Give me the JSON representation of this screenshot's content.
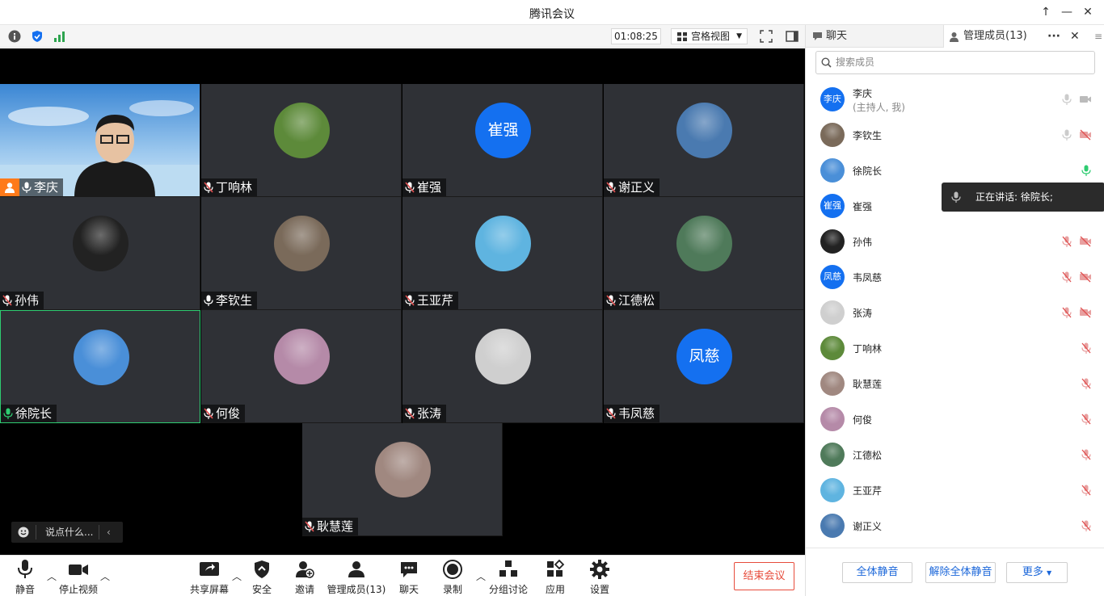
{
  "window": {
    "title": "腾讯会议"
  },
  "toolbar": {
    "timer": "01:08:25",
    "view_label": "宫格视图"
  },
  "tiles": [
    {
      "name": "李庆",
      "mic": "on",
      "self": true
    },
    {
      "name": "丁响林",
      "mic": "muted",
      "avatar_color": "#5d8a3a"
    },
    {
      "name": "崔强",
      "mic": "muted",
      "avatar_text": "崔强"
    },
    {
      "name": "谢正义",
      "mic": "muted",
      "avatar_color": "#4a7ab0"
    },
    {
      "name": "孙伟",
      "mic": "muted",
      "avatar_color": "#222222"
    },
    {
      "name": "李钦生",
      "mic": "on",
      "avatar_color": "#7a6a5a"
    },
    {
      "name": "王亚芹",
      "mic": "muted",
      "avatar_color": "#5fb4e0"
    },
    {
      "name": "江德松",
      "mic": "muted",
      "avatar_color": "#4f7a5a"
    },
    {
      "name": "徐院长",
      "mic": "speaking",
      "avatar_color": "#4a8fd8",
      "active": true
    },
    {
      "name": "何俊",
      "mic": "muted",
      "avatar_color": "#b58aa8"
    },
    {
      "name": "张涛",
      "mic": "muted",
      "avatar_color": "#cfcfcf"
    },
    {
      "name": "韦凤慈",
      "mic": "muted",
      "avatar_text": "凤慈"
    },
    {
      "name": "耿慧莲",
      "mic": "muted",
      "avatar_color": "#a08880"
    }
  ],
  "chat_input": {
    "placeholder": "说点什么..."
  },
  "bottom": {
    "mute": "静音",
    "stop_video": "停止视频",
    "share": "共享屏幕",
    "security": "安全",
    "invite": "邀请",
    "members": "管理成员(13)",
    "chat": "聊天",
    "record": "录制",
    "breakout": "分组讨论",
    "apps": "应用",
    "settings": "设置",
    "end": "结束会议"
  },
  "sidebar": {
    "tab_chat": "聊天",
    "tab_members": "管理成员(13)",
    "search_placeholder": "搜索成员",
    "speaking_label": "正在讲话: 徐院长;",
    "members": [
      {
        "name": "李庆",
        "sub": "(主持人, 我)",
        "avatar_text": "李庆",
        "mic": "off-gray",
        "cam": "on"
      },
      {
        "name": "李钦生",
        "avatar_color": "#7a6a5a",
        "mic": "off-gray",
        "cam": "off"
      },
      {
        "name": "徐院长",
        "avatar_color": "#4a8fd8",
        "mic": "speaking",
        "cam": "none"
      },
      {
        "name": "崔强",
        "avatar_text": "崔强",
        "mic": "muted",
        "cam": "off"
      },
      {
        "name": "孙伟",
        "avatar_color": "#222222",
        "mic": "muted",
        "cam": "off"
      },
      {
        "name": "韦凤慈",
        "avatar_text": "凤慈",
        "mic": "muted",
        "cam": "off"
      },
      {
        "name": "张涛",
        "avatar_color": "#cfcfcf",
        "mic": "muted",
        "cam": "off"
      },
      {
        "name": "丁响林",
        "avatar_color": "#5d8a3a",
        "mic": "muted",
        "cam": "none"
      },
      {
        "name": "耿慧莲",
        "avatar_color": "#a08880",
        "mic": "muted",
        "cam": "none"
      },
      {
        "name": "何俊",
        "avatar_color": "#b58aa8",
        "mic": "muted",
        "cam": "none"
      },
      {
        "name": "江德松",
        "avatar_color": "#4f7a5a",
        "mic": "muted",
        "cam": "none"
      },
      {
        "name": "王亚芹",
        "avatar_color": "#5fb4e0",
        "mic": "muted",
        "cam": "none"
      },
      {
        "name": "谢正义",
        "avatar_color": "#4a7ab0",
        "mic": "muted",
        "cam": "none"
      }
    ],
    "mute_all": "全体静音",
    "unmute_all": "解除全体静音",
    "more": "更多"
  },
  "colors": {
    "accent": "#1470f0",
    "end": "#e74c3c",
    "speaking": "#2ecc71",
    "muted": "#e05050"
  }
}
